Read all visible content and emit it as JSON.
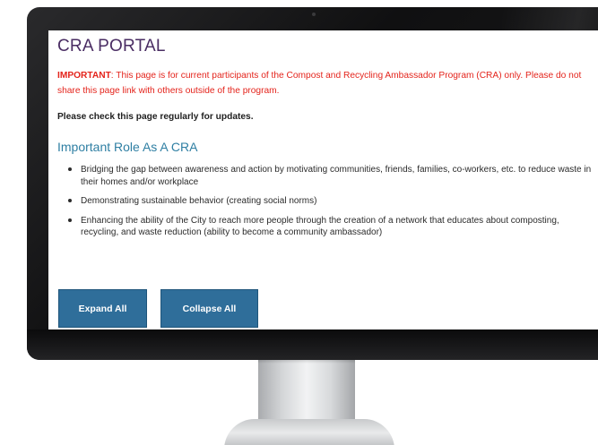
{
  "page": {
    "title": "CRA PORTAL",
    "notice": {
      "label": "IMPORTANT",
      "text": ": This page is for current participants of the Compost and Recycling Ambassador Program (CRA) only. Please do not share this page link with others outside of the program."
    },
    "updates_note": "Please check this page regularly for updates.",
    "section_heading": "Important Role As A CRA",
    "roles": [
      "Bridging the gap between awareness and action by motivating communities, friends, families, co-workers, etc. to reduce waste in their homes and/or workplace",
      "Demonstrating sustainable behavior (creating social norms)",
      "Enhancing the ability of the City to reach more people through the creation of a network that educates about composting, recycling, and waste reduction (ability to become a community ambassador)"
    ],
    "buttons": {
      "expand_label": "Expand All",
      "collapse_label": "Collapse All"
    }
  },
  "colors": {
    "title": "#4a2d63",
    "notice": "#e4241c",
    "heading": "#2f7fa3",
    "button": "#2f6e9a"
  }
}
